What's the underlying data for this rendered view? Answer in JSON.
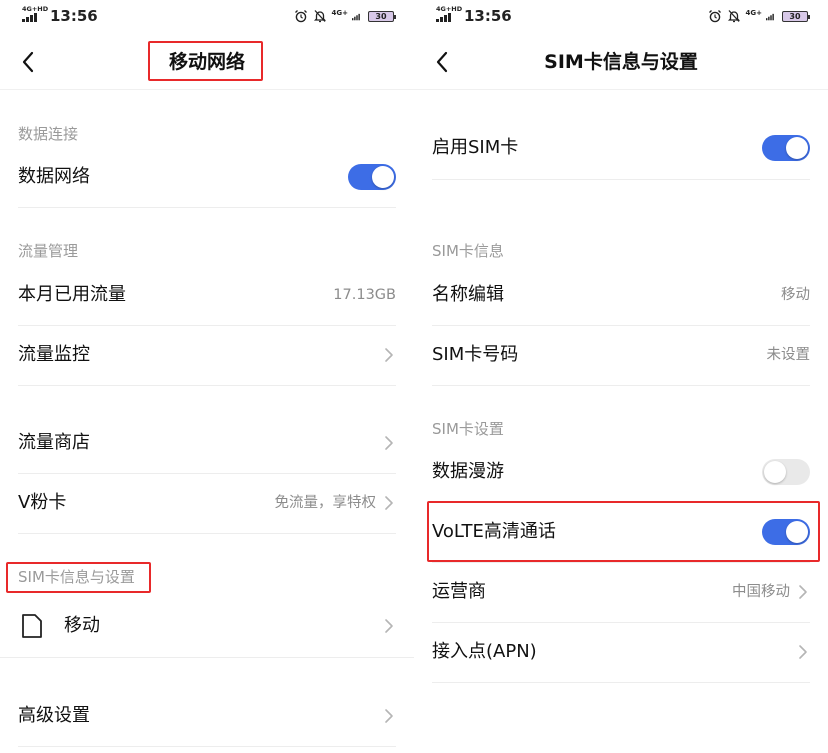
{
  "status_bar": {
    "network": "4G+HD",
    "time": "13:56",
    "network_right": "4G+",
    "battery": "30"
  },
  "left_screen": {
    "title": "移动网络",
    "sections": {
      "data_connection": "数据连接",
      "traffic_management": "流量管理",
      "sim_info": "SIM卡信息与设置"
    },
    "rows": {
      "data_network": {
        "label": "数据网络",
        "toggle": "on"
      },
      "monthly_usage": {
        "label": "本月已用流量",
        "value": "17.13GB"
      },
      "traffic_monitor": {
        "label": "流量监控"
      },
      "traffic_store": {
        "label": "流量商店"
      },
      "v_card": {
        "label": "V粉卡",
        "value": "免流量，享特权"
      },
      "sim_mobile": {
        "label": "移动"
      },
      "advanced": {
        "label": "高级设置"
      }
    }
  },
  "right_screen": {
    "title": "SIM卡信息与设置",
    "sections": {
      "sim_info": "SIM卡信息",
      "sim_settings": "SIM卡设置"
    },
    "rows": {
      "enable_sim": {
        "label": "启用SIM卡",
        "toggle": "on"
      },
      "name_edit": {
        "label": "名称编辑",
        "value": "移动"
      },
      "sim_number": {
        "label": "SIM卡号码",
        "value": "未设置"
      },
      "data_roaming": {
        "label": "数据漫游",
        "toggle": "off"
      },
      "volte": {
        "label": "VoLTE高清通话",
        "toggle": "on"
      },
      "carrier": {
        "label": "运营商",
        "value": "中国移动"
      },
      "apn": {
        "label": "接入点(APN)"
      }
    }
  },
  "colors": {
    "accent": "#3d6de6",
    "highlight": "#e8292a",
    "section_text": "#9a9a9a",
    "value_text": "#8c8c8c"
  },
  "icons": [
    "signal-icon",
    "alarm-icon",
    "mute-bell-icon",
    "battery-icon",
    "back-arrow-icon",
    "chevron-right-icon",
    "sim-card-icon"
  ]
}
